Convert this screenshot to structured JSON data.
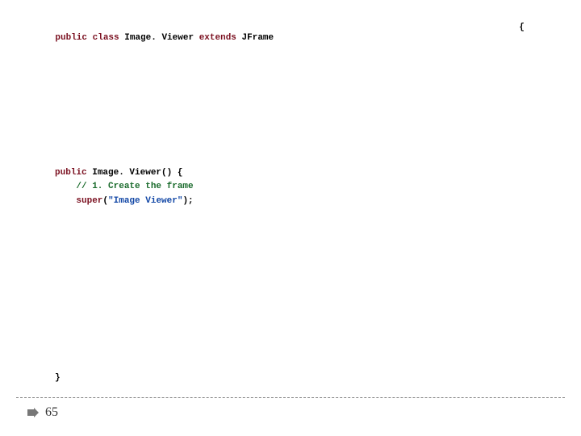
{
  "code": {
    "line1": {
      "kw_public": "public",
      "kw_class": "class",
      "classname": "Image. Viewer",
      "kw_extends": "extends",
      "supertype": "JFrame",
      "open_brace": "{"
    },
    "ctor": {
      "decl_public": "public",
      "decl_name": "Image. Viewer()",
      "decl_brace": "{",
      "comment": "// 1. Create the frame",
      "super_kw": "super",
      "super_open": "(",
      "super_arg": "\"Image Viewer\"",
      "super_close": ");"
    },
    "close_brace": "}"
  },
  "footer": {
    "page_number": "65"
  }
}
